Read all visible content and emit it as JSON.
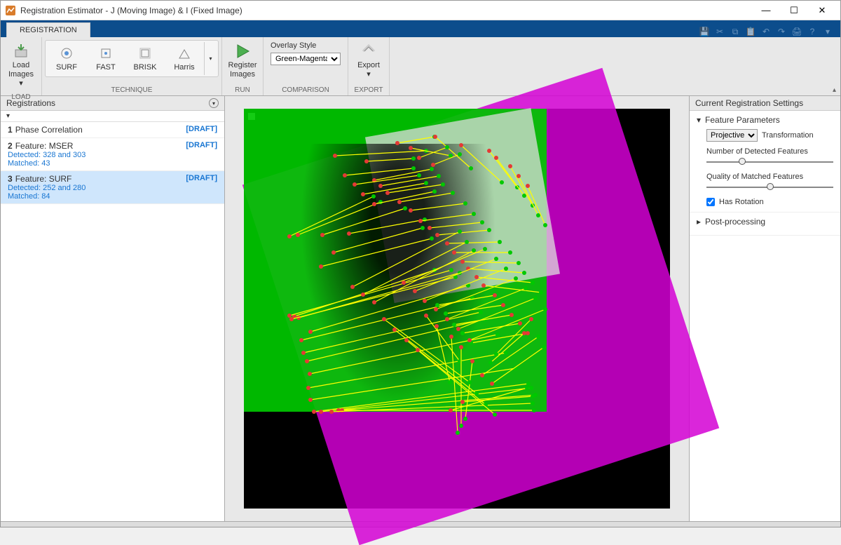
{
  "window": {
    "title": "Registration Estimator - J (Moving Image)  &  I (Fixed Image)"
  },
  "ribbon": {
    "tab": "REGISTRATION",
    "groups": {
      "load": {
        "label": "LOAD",
        "btn": "Load Images ▾"
      },
      "technique": {
        "label": "TECHNIQUE",
        "buttons": [
          "SURF",
          "FAST",
          "BRISK",
          "Harris"
        ]
      },
      "run": {
        "label": "RUN",
        "btn": "Register Images"
      },
      "comparison": {
        "label": "COMPARISON",
        "overlay_label": "Overlay Style",
        "overlay_value": "Green-Magenta"
      },
      "export": {
        "label": "EXPORT",
        "btn": "Export ▾"
      }
    }
  },
  "left_panel": {
    "title": "Registrations",
    "items": [
      {
        "num": "1",
        "title": "Phase Correlation",
        "draft": "[DRAFT]"
      },
      {
        "num": "2",
        "title": "Feature: MSER",
        "draft": "[DRAFT]",
        "detected": "Detected: 328 and 303",
        "matched": "Matched: 43"
      },
      {
        "num": "3",
        "title": "Feature: SURF",
        "draft": "[DRAFT]",
        "detected": "Detected: 252 and 280",
        "matched": "Matched: 84"
      }
    ]
  },
  "right_panel": {
    "title": "Current Registration Settings",
    "feature_section": "Feature Parameters",
    "transformation_label": "Transformation",
    "transformation_value": "Projective",
    "num_detected": "Number of Detected Features",
    "quality_matched": "Quality of Matched Features",
    "has_rotation": "Has Rotation",
    "postprocessing": "Post-processing"
  },
  "matches": [
    [
      130,
      67,
      260,
      60
    ],
    [
      175,
      75,
      242,
      71
    ],
    [
      219,
      49,
      272,
      40
    ],
    [
      238,
      56,
      295,
      67
    ],
    [
      273,
      40,
      324,
      85
    ],
    [
      310,
      52,
      368,
      105
    ],
    [
      65,
      182,
      185,
      125
    ],
    [
      77,
      180,
      195,
      133
    ],
    [
      112,
      180,
      230,
      142
    ],
    [
      150,
      178,
      258,
      158
    ],
    [
      128,
      205,
      255,
      170
    ],
    [
      110,
      225,
      268,
      185
    ],
    [
      72,
      296,
      272,
      230
    ],
    [
      65,
      295,
      296,
      230
    ],
    [
      78,
      298,
      308,
      234
    ],
    [
      68,
      300,
      302,
      240
    ],
    [
      95,
      318,
      320,
      252
    ],
    [
      82,
      330,
      326,
      270
    ],
    [
      85,
      348,
      338,
      290
    ],
    [
      90,
      360,
      344,
      300
    ],
    [
      94,
      378,
      362,
      322
    ],
    [
      92,
      398,
      374,
      348
    ],
    [
      95,
      415,
      388,
      370
    ],
    [
      100,
      432,
      406,
      392
    ],
    [
      110,
      432,
      410,
      398
    ],
    [
      135,
      430,
      416,
      408
    ],
    [
      140,
      430,
      414,
      430
    ],
    [
      125,
      432,
      412,
      420
    ],
    [
      186,
      102,
      268,
      86
    ],
    [
      195,
      110,
      278,
      96
    ],
    [
      205,
      120,
      284,
      108
    ],
    [
      222,
      133,
      298,
      120
    ],
    [
      238,
      145,
      316,
      135
    ],
    [
      252,
      160,
      328,
      150
    ],
    [
      265,
      170,
      340,
      162
    ],
    [
      276,
      180,
      350,
      173
    ],
    [
      290,
      192,
      365,
      190
    ],
    [
      300,
      205,
      380,
      205
    ],
    [
      312,
      218,
      392,
      220
    ],
    [
      320,
      228,
      400,
      234
    ],
    [
      332,
      240,
      412,
      248
    ],
    [
      342,
      252,
      424,
      262
    ],
    [
      358,
      266,
      276,
      280
    ],
    [
      370,
      280,
      288,
      292
    ],
    [
      382,
      294,
      300,
      308
    ],
    [
      394,
      306,
      312,
      320
    ],
    [
      405,
      320,
      324,
      334
    ],
    [
      260,
      295,
      308,
      360
    ],
    [
      275,
      310,
      294,
      390
    ],
    [
      296,
      325,
      305,
      462
    ],
    [
      310,
      340,
      310,
      452
    ],
    [
      326,
      360,
      316,
      442
    ],
    [
      295,
      430,
      404,
      398
    ],
    [
      312,
      418,
      412,
      410
    ],
    [
      350,
      60,
      390,
      112
    ],
    [
      360,
      70,
      400,
      124
    ],
    [
      380,
      82,
      412,
      138
    ],
    [
      392,
      96,
      420,
      152
    ],
    [
      405,
      110,
      430,
      166
    ],
    [
      228,
      248,
      344,
      200
    ],
    [
      244,
      260,
      360,
      214
    ],
    [
      258,
      274,
      374,
      228
    ],
    [
      274,
      286,
      388,
      242
    ],
    [
      290,
      300,
      402,
      256
    ],
    [
      306,
      314,
      416,
      270
    ],
    [
      322,
      330,
      430,
      286
    ],
    [
      155,
      254,
      308,
      175
    ],
    [
      170,
      265,
      318,
      190
    ],
    [
      186,
      276,
      328,
      202
    ],
    [
      340,
      380,
      420,
      325
    ],
    [
      354,
      392,
      428,
      340
    ],
    [
      250,
      70,
      290,
      55
    ],
    [
      270,
      80,
      308,
      65
    ],
    [
      200,
      300,
      322,
      390
    ],
    [
      215,
      315,
      332,
      406
    ],
    [
      232,
      330,
      345,
      422
    ],
    [
      248,
      344,
      358,
      436
    ],
    [
      144,
      95,
      242,
      85
    ],
    [
      158,
      108,
      250,
      95
    ],
    [
      170,
      122,
      260,
      106
    ],
    [
      186,
      136,
      272,
      118
    ],
    [
      410,
      300,
      360,
      350
    ],
    [
      400,
      320,
      352,
      362
    ]
  ]
}
